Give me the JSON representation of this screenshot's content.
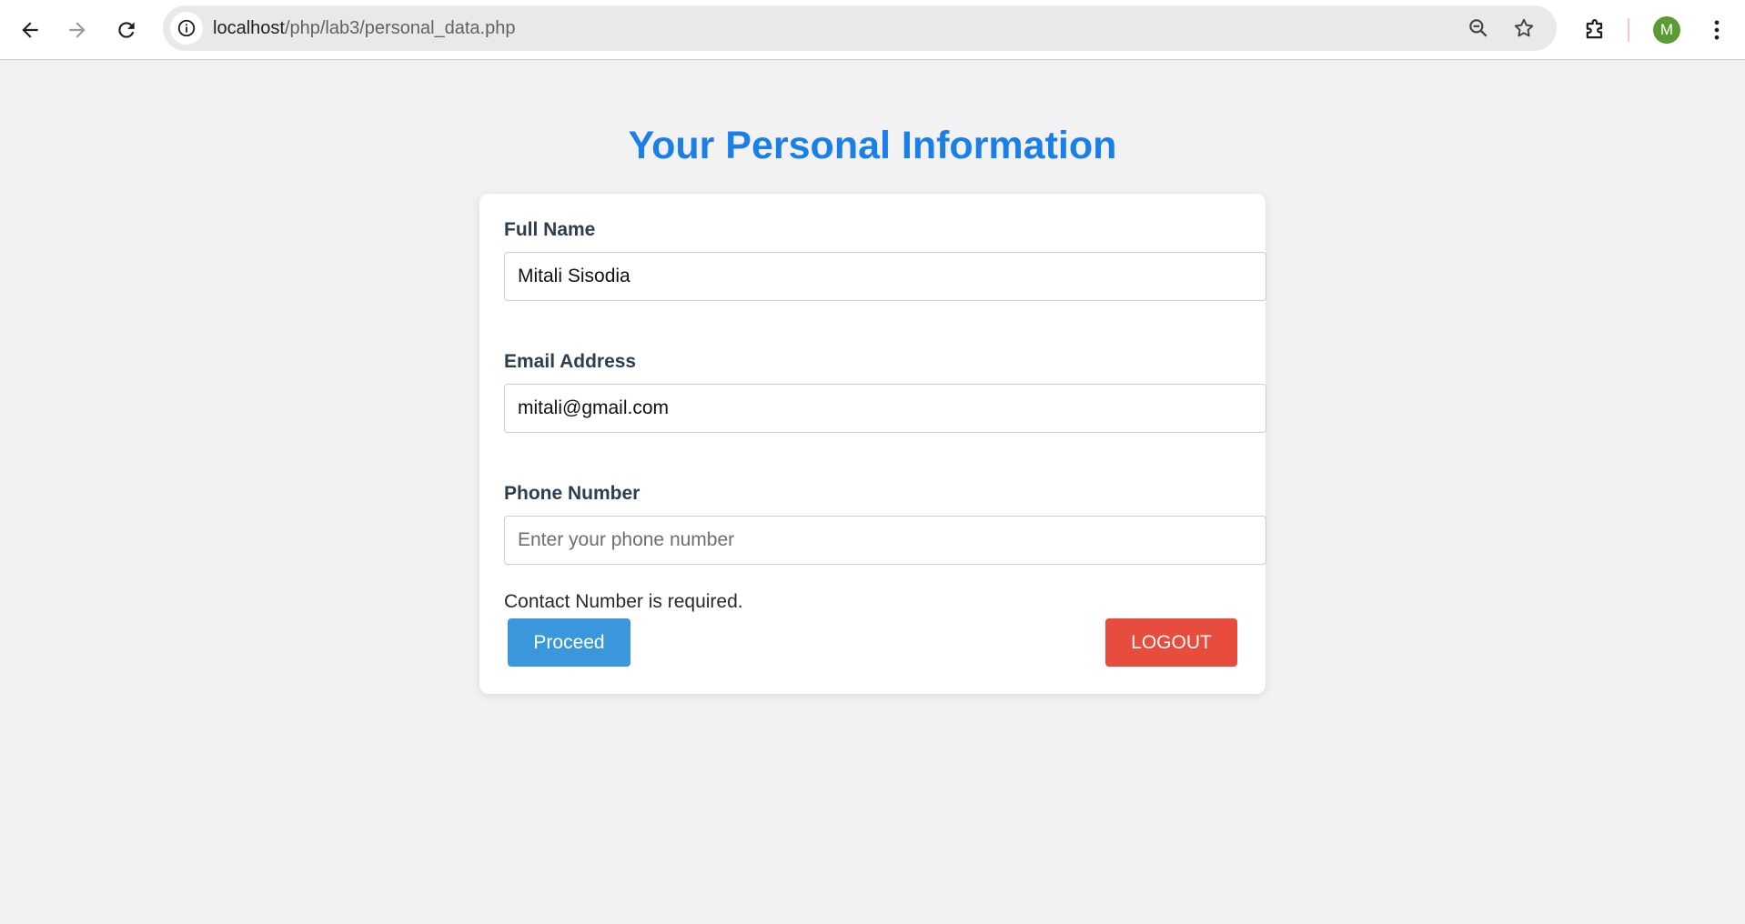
{
  "browser": {
    "url_host": "localhost",
    "url_path": "/php/lab3/personal_data.php",
    "profile_initial": "M"
  },
  "page": {
    "title": "Your Personal Information"
  },
  "form": {
    "full_name": {
      "label": "Full Name",
      "value": "Mitali Sisodia"
    },
    "email": {
      "label": "Email Address",
      "value": "mitali@gmail.com"
    },
    "phone": {
      "label": "Phone Number",
      "value": "",
      "placeholder": "Enter your phone number"
    },
    "error_message": "Contact Number is required.",
    "proceed_label": "Proceed",
    "logout_label": "LOGOUT"
  },
  "colors": {
    "title": "#1a7fe8",
    "proceed_button": "#3a97dc",
    "logout_button": "#e74c3c",
    "label_text": "#2c3e50",
    "page_background": "#f2f2f2",
    "avatar": "#5b9b34"
  }
}
